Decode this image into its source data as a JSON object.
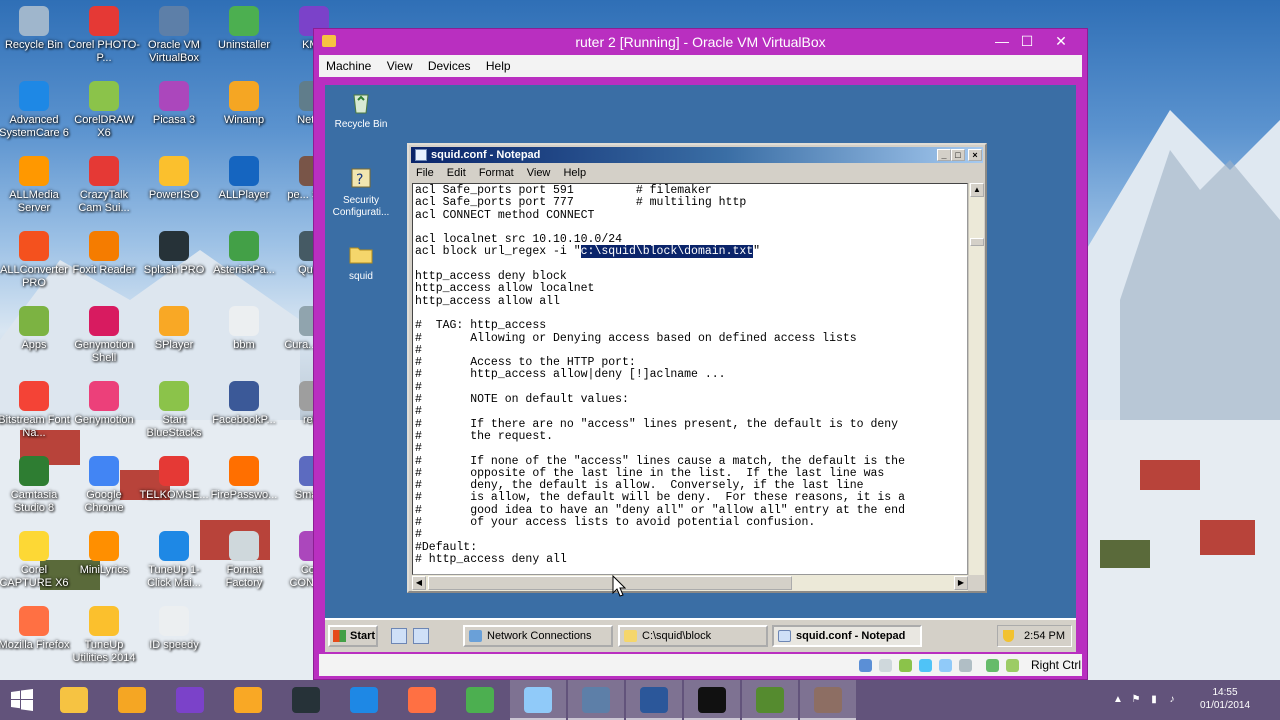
{
  "host_desktop": {
    "icons": [
      {
        "label": "Recycle Bin",
        "color": "#9fb6cc"
      },
      {
        "label": "Corel PHOTO-P...",
        "color": "#e53935"
      },
      {
        "label": "Oracle VM VirtualBox",
        "color": "#5d7fa8"
      },
      {
        "label": "Uninstaller",
        "color": "#4caf50"
      },
      {
        "label": "KMP",
        "color": "#7b42c9"
      },
      {
        "label": "Advanced SystemCare 6",
        "color": "#1e88e5"
      },
      {
        "label": "CorelDRAW X6",
        "color": "#8bc34a"
      },
      {
        "label": "Picasa 3",
        "color": "#ab47bc"
      },
      {
        "label": "Winamp",
        "color": "#f5a623"
      },
      {
        "label": "Netw...",
        "color": "#607d8b"
      },
      {
        "label": "ALLMedia Server",
        "color": "#ff9800"
      },
      {
        "label": "CrazyTalk Cam Sui...",
        "color": "#e53935"
      },
      {
        "label": "PowerISO",
        "color": "#fbc02d"
      },
      {
        "label": "ALLPlayer",
        "color": "#1565c0"
      },
      {
        "label": "pe... Sho...",
        "color": "#795548"
      },
      {
        "label": "ALLConverter PRO",
        "color": "#f4511e"
      },
      {
        "label": "Foxit Reader",
        "color": "#f57c00"
      },
      {
        "label": "Splash PRO",
        "color": "#263238"
      },
      {
        "label": "AsteriskPa...",
        "color": "#43a047"
      },
      {
        "label": "Quic...",
        "color": "#455a64"
      },
      {
        "label": "Apps",
        "color": "#7cb342"
      },
      {
        "label": "Genymotion Shell",
        "color": "#d81b60"
      },
      {
        "label": "SPlayer",
        "color": "#f9a825"
      },
      {
        "label": "bbm",
        "color": "#eceff1"
      },
      {
        "label": "Cura... Re...",
        "color": "#90a4ae"
      },
      {
        "label": "Bitstream Font Na...",
        "color": "#f44336"
      },
      {
        "label": "Genymotion",
        "color": "#ec407a"
      },
      {
        "label": "Start BlueStacks",
        "color": "#8bc34a"
      },
      {
        "label": "FacebookP...",
        "color": "#3b5998"
      },
      {
        "label": "ref...",
        "color": "#9e9e9e"
      },
      {
        "label": "Camtasia Studio 8",
        "color": "#2e7d32"
      },
      {
        "label": "Google Chrome",
        "color": "#4285f4"
      },
      {
        "label": "TELKOMSE...",
        "color": "#e53935"
      },
      {
        "label": "FirePasswo...",
        "color": "#ff6f00"
      },
      {
        "label": "Smart...",
        "color": "#5c6bc0"
      },
      {
        "label": "Corel CAPTURE X6",
        "color": "#fdd835"
      },
      {
        "label": "MiniLyrics",
        "color": "#ff8f00"
      },
      {
        "label": "TuneUp 1-Click Mai...",
        "color": "#1e88e5"
      },
      {
        "label": "Format Factory",
        "color": "#cfd8dc"
      },
      {
        "label": "Corel CONNE...",
        "color": "#ab47bc"
      },
      {
        "label": "Mozilla Firefox",
        "color": "#ff7043"
      },
      {
        "label": "TuneUp Utilities 2014",
        "color": "#fbc02d"
      },
      {
        "label": "ID speedy",
        "color": "#eceff1"
      }
    ]
  },
  "vbox": {
    "title": "ruter 2 [Running] - Oracle VM VirtualBox",
    "accent": "#b92fc0",
    "controls": {
      "minimize": "—",
      "maximize": "☐",
      "close": "✕"
    },
    "menu": [
      "Machine",
      "View",
      "Devices",
      "Help"
    ],
    "status_right": "Right Ctrl"
  },
  "guest_desktop": {
    "background": "#3a6ea5",
    "icons": [
      {
        "label": "Recycle Bin",
        "icon": "recycle-bin-icon"
      },
      {
        "label": "Security Configurati...",
        "icon": "security-config-icon"
      },
      {
        "label": "squid",
        "icon": "folder-icon"
      }
    ]
  },
  "notepad": {
    "title": "squid.conf - Notepad",
    "menu": [
      "File",
      "Edit",
      "Format",
      "View",
      "Help"
    ],
    "lines": [
      "acl Safe_ports port 591         # filemaker",
      "acl Safe_ports port 777         # multiling http",
      "acl CONNECT method CONNECT",
      "",
      "acl localnet src 10.10.10.0/24",
      "acl block url_regex -i \"",
      "",
      "http_access deny block",
      "http_access allow localnet",
      "http_access allow all",
      "",
      "#  TAG: http_access",
      "#       Allowing or Denying access based on defined access lists",
      "#",
      "#       Access to the HTTP port:",
      "#       http_access allow|deny [!]aclname ...",
      "#",
      "#       NOTE on default values:",
      "#",
      "#       If there are no \"access\" lines present, the default is to deny",
      "#       the request.",
      "#",
      "#       If none of the \"access\" lines cause a match, the default is the",
      "#       opposite of the last line in the list.  If the last line was",
      "#       deny, the default is allow.  Conversely, if the last line",
      "#       is allow, the default will be deny.  For these reasons, it is a",
      "#       good idea to have an \"deny all\" or \"allow all\" entry at the end",
      "#       of your access lists to avoid potential confusion.",
      "#",
      "#Default:",
      "# http_access deny all"
    ],
    "selected_text": "c:\\squid\\block\\domain.txt",
    "after_selection": "\""
  },
  "guest_taskbar": {
    "start_label": "Start",
    "tasks": [
      {
        "label": "Network Connections",
        "active": false
      },
      {
        "label": "C:\\squid\\block",
        "active": false
      },
      {
        "label": "squid.conf - Notepad",
        "active": true
      }
    ],
    "clock": "2:54 PM"
  },
  "host_taskbar": {
    "apps": [
      {
        "name": "file-explorer",
        "color": "#f6c342",
        "running": false
      },
      {
        "name": "keygen",
        "color": "#f5a623",
        "running": false
      },
      {
        "name": "visual-studio",
        "color": "#7b42c9",
        "running": false
      },
      {
        "name": "media-player",
        "color": "#f9a825",
        "running": false
      },
      {
        "name": "splash-pro",
        "color": "#263238",
        "running": false
      },
      {
        "name": "internet-explorer",
        "color": "#1e88e5",
        "running": false
      },
      {
        "name": "firefox",
        "color": "#ff7043",
        "running": false
      },
      {
        "name": "chrome",
        "color": "#4caf50",
        "running": false
      },
      {
        "name": "control-panel",
        "color": "#90caf9",
        "running": true
      },
      {
        "name": "virtualbox",
        "color": "#5d7fa8",
        "running": true
      },
      {
        "name": "word",
        "color": "#2b579a",
        "running": true
      },
      {
        "name": "command-prompt",
        "color": "#111111",
        "running": true
      },
      {
        "name": "app-1",
        "color": "#558b2f",
        "running": true
      },
      {
        "name": "app-2",
        "color": "#8d6e63",
        "running": true
      }
    ],
    "time": "14:55",
    "date": "01/01/2014"
  }
}
